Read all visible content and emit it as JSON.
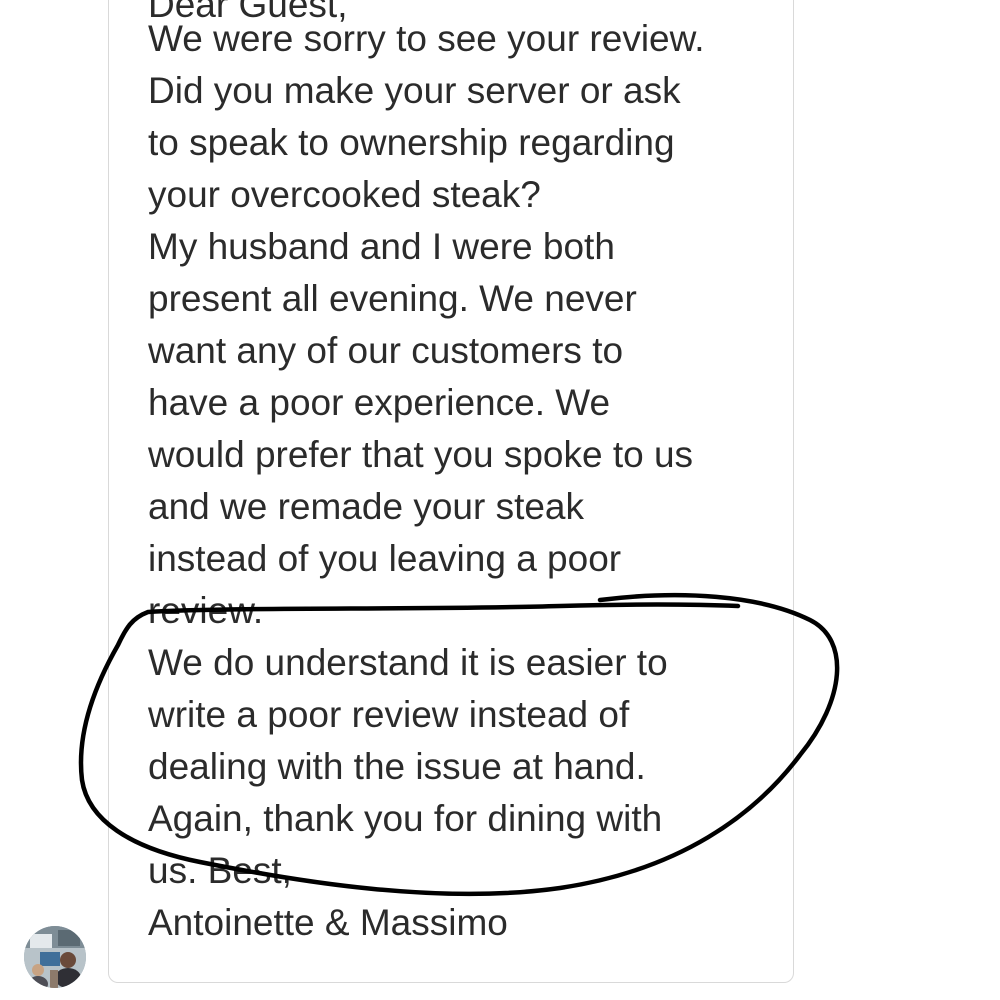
{
  "review_response": {
    "top_fragment": "Dear Guest,",
    "lines": [
      "We were sorry to see your review.",
      "Did you make your server or ask",
      "to speak to ownership regarding",
      "your overcooked steak?",
      "My husband and I were both",
      "present all evening. We never",
      "want any of our customers to",
      "have a poor experience. We",
      "would prefer that you spoke to us",
      "and we remade your steak",
      "instead of you leaving a poor",
      "review.",
      "We do understand it is easier to",
      "write a poor review instead of",
      "dealing with the issue at hand.",
      "Again, thank you for dining with",
      "us. Best,",
      "Antoinette & Massimo"
    ]
  },
  "owner": {
    "avatar_icon": "owner-avatar-photo"
  },
  "annotation": {
    "color": "#000000",
    "shape": "hand-drawn-circle"
  },
  "colors": {
    "text": "#2b2b2b",
    "card_border": "#d9d9d9",
    "background": "#ffffff"
  }
}
